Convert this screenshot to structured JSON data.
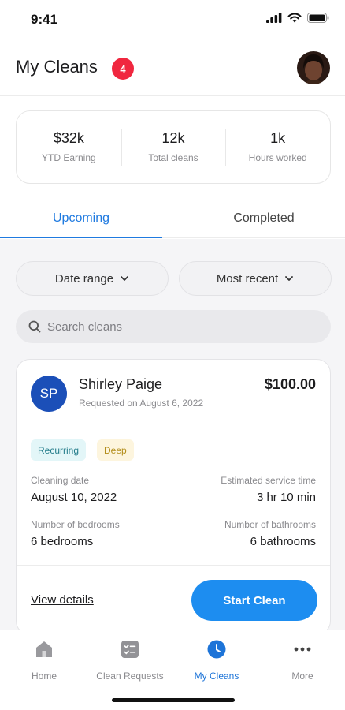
{
  "status": {
    "time": "9:41"
  },
  "header": {
    "title": "My Cleans",
    "badge_count": "4"
  },
  "stats": [
    {
      "value": "$32k",
      "label": "YTD Earning"
    },
    {
      "value": "12k",
      "label": "Total cleans"
    },
    {
      "value": "1k",
      "label": "Hours worked"
    }
  ],
  "tabs": {
    "upcoming": "Upcoming",
    "completed": "Completed",
    "active": "Upcoming"
  },
  "filters": {
    "date_range": "Date range",
    "sort": "Most recent"
  },
  "search": {
    "placeholder": "Search cleans"
  },
  "job": {
    "initials": "SP",
    "client_name": "Shirley Paige",
    "requested": "Requested on August 6, 2022",
    "price": "$100.00",
    "tags": [
      "Recurring",
      "Deep"
    ],
    "cleaning_date_label": "Cleaning date",
    "cleaning_date": "August 10, 2022",
    "service_time_label": "Estimated service time",
    "service_time": "3 hr 10 min",
    "bedrooms_label": "Number of bedrooms",
    "bedrooms": "6 bedrooms",
    "bathrooms_label": "Number of bathrooms",
    "bathrooms": "6 bathrooms",
    "view_details": "View details",
    "start_button": "Start Clean"
  },
  "nav": {
    "items": [
      {
        "label": "Home",
        "icon": "home-icon"
      },
      {
        "label": "Clean Requests",
        "icon": "checklist-icon"
      },
      {
        "label": "My Cleans",
        "icon": "clock-icon"
      },
      {
        "label": "More",
        "icon": "more-icon"
      }
    ],
    "active": "My Cleans"
  },
  "colors": {
    "accent": "#1f7ae0",
    "primary_button": "#1d8df0",
    "badge": "#f0273f",
    "client_avatar": "#1b4fb8",
    "tag_recurring_bg": "#e3f6f8",
    "tag_deep_bg": "#fdf5de"
  }
}
